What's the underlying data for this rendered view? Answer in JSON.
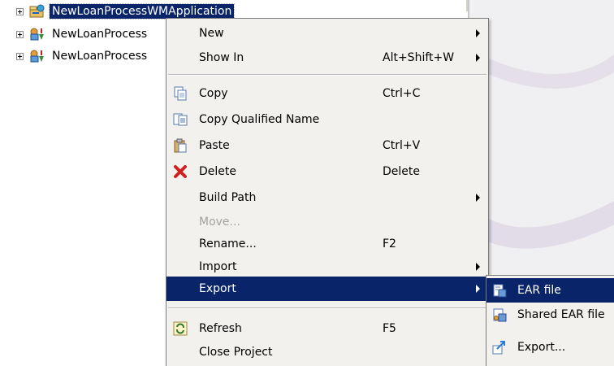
{
  "tree": {
    "items": [
      {
        "label": "NewLoanProcessWMApplication",
        "selected": true,
        "icon": "application-project-icon"
      },
      {
        "label": "NewLoanProcess",
        "selected": false,
        "icon": "ejb-project-icon"
      },
      {
        "label": "NewLoanProcess",
        "selected": false,
        "icon": "ejb-project-icon"
      }
    ]
  },
  "context_menu": {
    "items": [
      {
        "label": "New",
        "accel": "",
        "submenu": true,
        "icon": "",
        "enabled": true
      },
      {
        "label": "Show In",
        "accel": "Alt+Shift+W",
        "submenu": true,
        "icon": "",
        "enabled": true
      },
      {
        "label": "Copy",
        "accel": "Ctrl+C",
        "submenu": false,
        "icon": "copy-icon",
        "enabled": true
      },
      {
        "label": "Copy Qualified Name",
        "accel": "",
        "submenu": false,
        "icon": "copy-qualified-name-icon",
        "enabled": true
      },
      {
        "label": "Paste",
        "accel": "Ctrl+V",
        "submenu": false,
        "icon": "paste-icon",
        "enabled": true
      },
      {
        "label": "Delete",
        "accel": "Delete",
        "submenu": false,
        "icon": "delete-icon",
        "enabled": true
      },
      {
        "label": "Build Path",
        "accel": "",
        "submenu": true,
        "icon": "",
        "enabled": true
      },
      {
        "label": "Move...",
        "accel": "",
        "submenu": false,
        "icon": "",
        "enabled": false
      },
      {
        "label": "Rename...",
        "accel": "F2",
        "submenu": false,
        "icon": "",
        "enabled": true
      },
      {
        "label": "Import",
        "accel": "",
        "submenu": true,
        "icon": "",
        "enabled": true
      },
      {
        "label": "Export",
        "accel": "",
        "submenu": true,
        "icon": "",
        "enabled": true,
        "highlighted": true
      },
      {
        "label": "Refresh",
        "accel": "F5",
        "submenu": false,
        "icon": "refresh-icon",
        "enabled": true
      },
      {
        "label": "Close Project",
        "accel": "",
        "submenu": false,
        "icon": "",
        "enabled": true
      }
    ]
  },
  "export_submenu": {
    "items": [
      {
        "label": "EAR file",
        "icon": "ear-file-icon",
        "highlighted": true
      },
      {
        "label": "Shared EAR file",
        "icon": "shared-ear-file-icon",
        "highlighted": false
      },
      {
        "label": "Export...",
        "icon": "export-wizard-icon",
        "highlighted": false
      }
    ]
  },
  "colors": {
    "selection": "#0a246a",
    "menu_background": "#f2f1ee",
    "disabled_text": "#a3a3a3"
  }
}
